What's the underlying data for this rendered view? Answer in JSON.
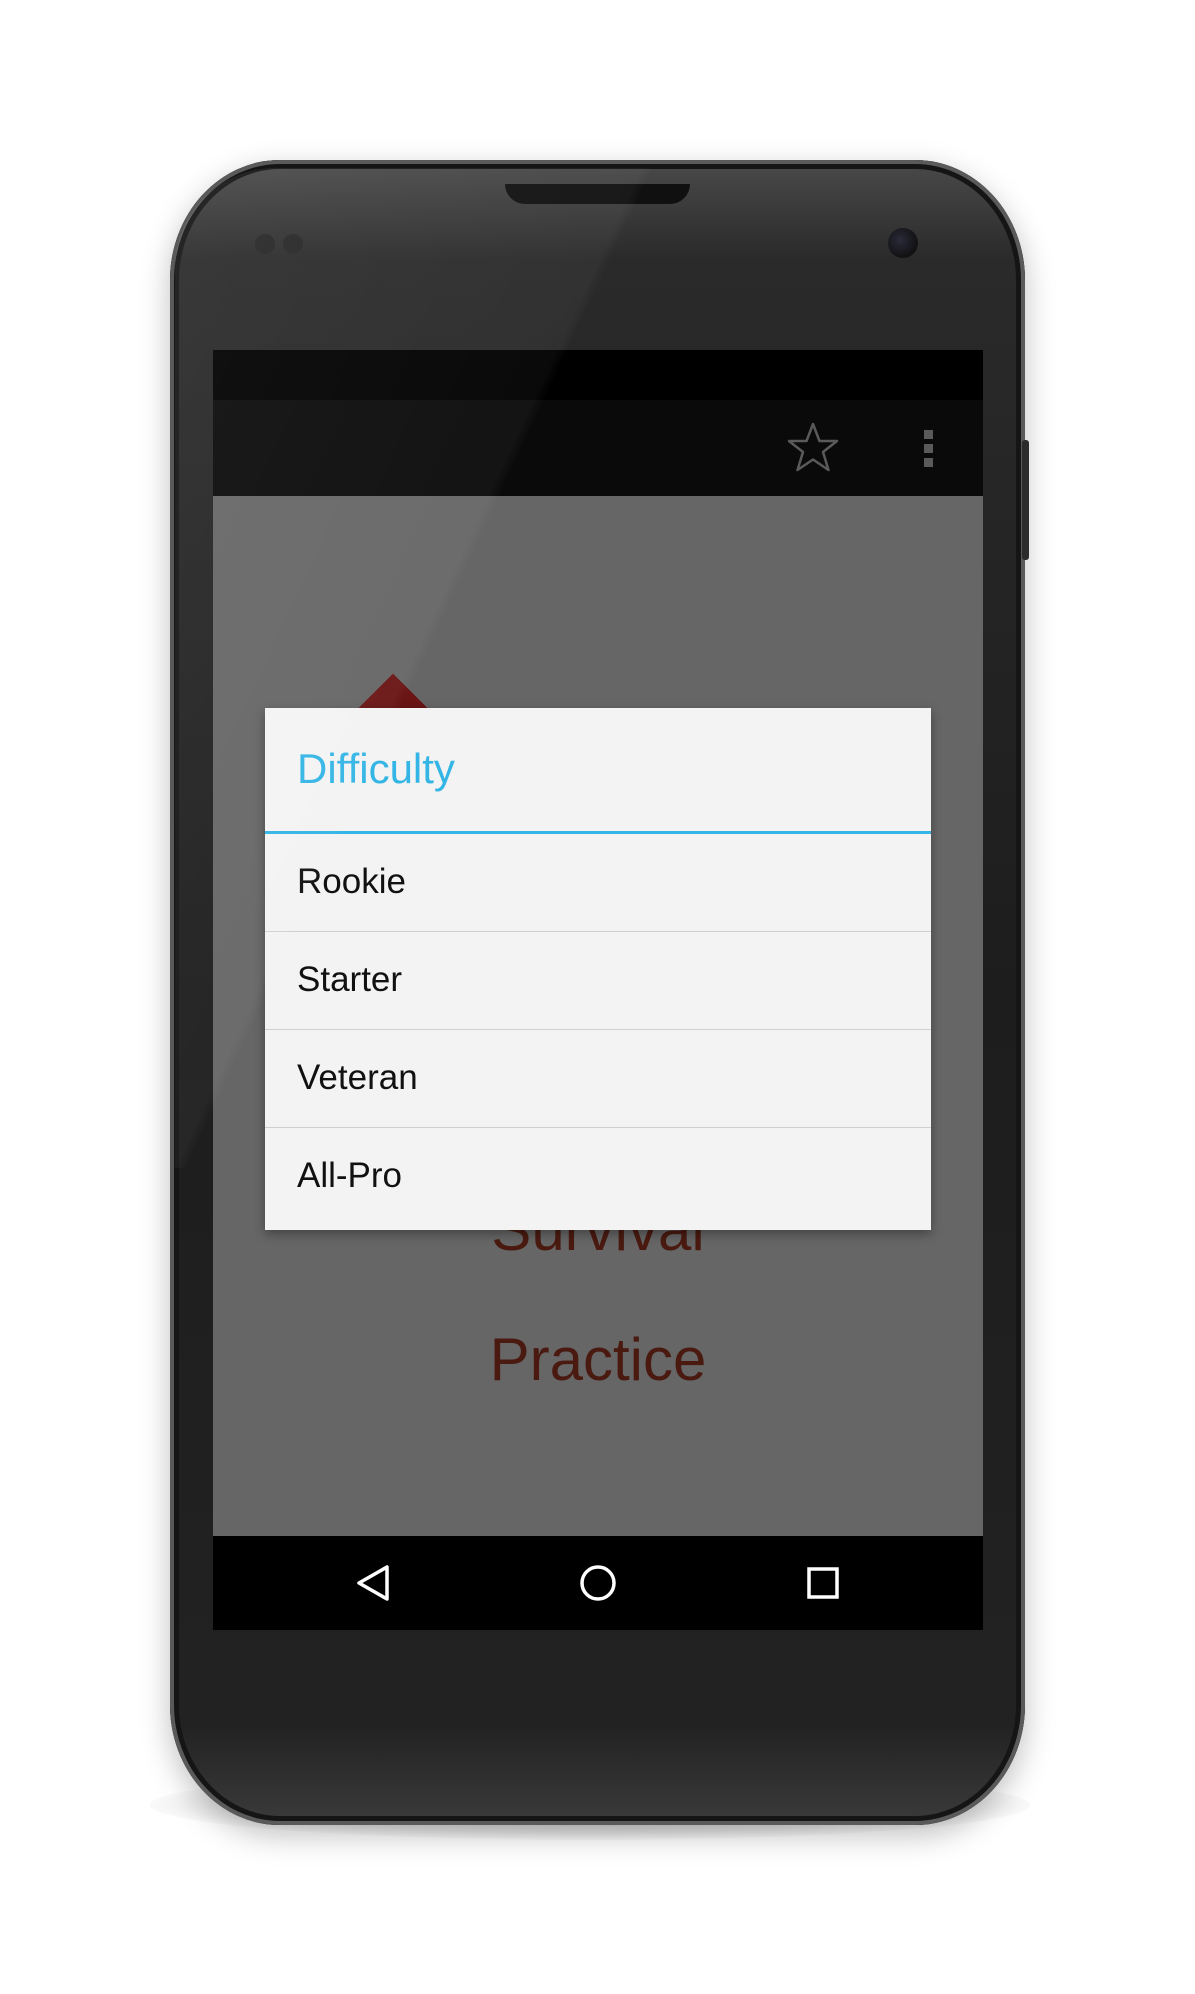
{
  "action_bar": {
    "star_icon": "star-outline-icon",
    "overflow_icon": "overflow-menu-icon"
  },
  "background_menu": {
    "items": [
      {
        "label": "Survival"
      },
      {
        "label": "Practice"
      }
    ],
    "text_color": "#4a1a10"
  },
  "dialog": {
    "title": "Difficulty",
    "accent_color": "#33b5e5",
    "options": [
      {
        "label": "Rookie"
      },
      {
        "label": "Starter"
      },
      {
        "label": "Veteran"
      },
      {
        "label": "All-Pro"
      }
    ]
  },
  "nav_bar": {
    "back_icon": "back-triangle-icon",
    "home_icon": "home-circle-icon",
    "recent_icon": "recent-apps-square-icon"
  }
}
